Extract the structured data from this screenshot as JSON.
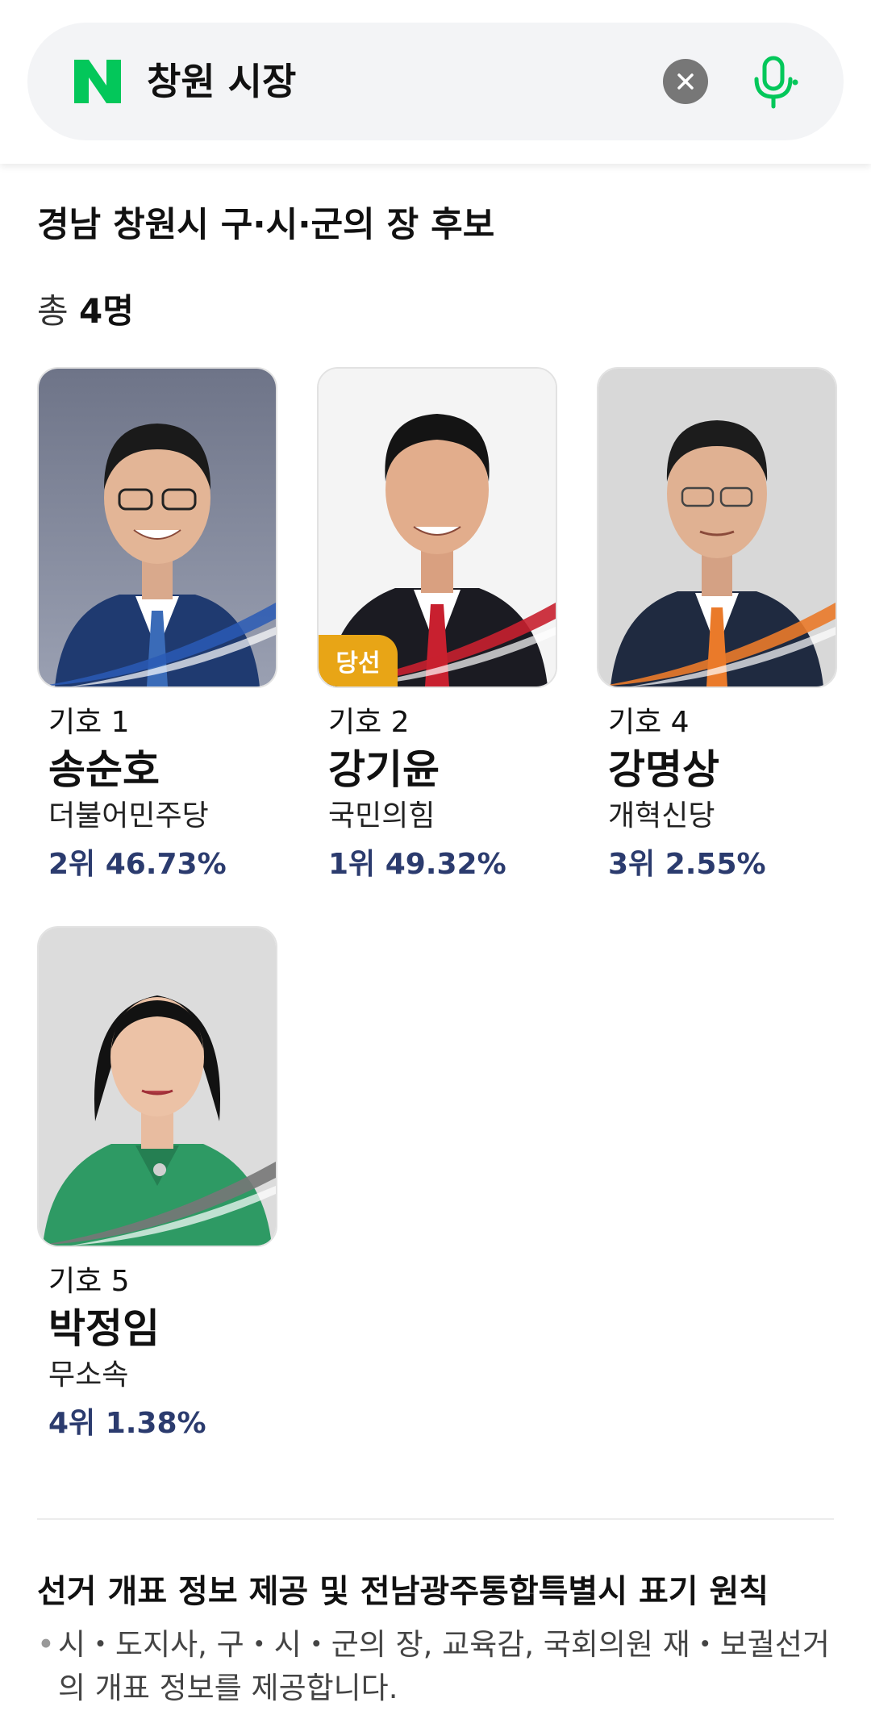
{
  "search": {
    "logo_letter": "N",
    "query": "창원 시장"
  },
  "section": {
    "title": "경남 창원시 구·시·군의 장 후보",
    "total_prefix": "총 ",
    "total_count": "4명"
  },
  "candidates": [
    {
      "symbol": "기호 1",
      "name": "송순호",
      "party": "더불어민주당",
      "result": "2위 46.73%",
      "rank": 2,
      "percent": 46.73,
      "accent": "#2a5bb5",
      "badge": ""
    },
    {
      "symbol": "기호 2",
      "name": "강기윤",
      "party": "국민의힘",
      "result": "1위 49.32%",
      "rank": 1,
      "percent": 49.32,
      "accent": "#c8202f",
      "badge": "당선"
    },
    {
      "symbol": "기호 4",
      "name": "강명상",
      "party": "개혁신당",
      "result": "3위 2.55%",
      "rank": 3,
      "percent": 2.55,
      "accent": "#ea7a2a",
      "badge": ""
    },
    {
      "symbol": "기호 5",
      "name": "박정임",
      "party": "무소속",
      "result": "4위 1.38%",
      "rank": 4,
      "percent": 1.38,
      "accent": "#777777",
      "badge": ""
    }
  ],
  "notice": {
    "title": "선거 개표 정보 제공 및 전남광주통합특별시 표기 원칙",
    "bullet": "•",
    "text": "시・도지사, 구・시・군의 장, 교육감, 국회의원 재・보궐선거의 개표 정보를 제공합니다."
  },
  "colors": {
    "naver_green": "#03c75a",
    "result_navy": "#2b3b6e",
    "win_badge": "#e8a516"
  },
  "icons": [
    "naver-logo-icon",
    "clear-icon",
    "mic-icon"
  ]
}
